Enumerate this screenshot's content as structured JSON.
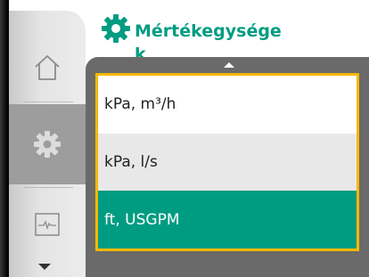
{
  "header": {
    "icon": "gear-icon",
    "title": "Mértékegységek"
  },
  "sidebar": {
    "items": [
      {
        "name": "home",
        "icon": "home-icon",
        "selected": false
      },
      {
        "name": "settings",
        "icon": "gear-icon",
        "selected": true
      },
      {
        "name": "diagnostics",
        "icon": "waveform-icon",
        "selected": false
      }
    ]
  },
  "units_list": {
    "options": [
      {
        "label": "kPa, m³/h",
        "selected": false
      },
      {
        "label": "kPa, l/s",
        "selected": false
      },
      {
        "label": "ft, USGPM",
        "selected": true
      }
    ]
  },
  "colors": {
    "accent": "#009c82",
    "focus": "#f5b800",
    "panel": "#6a6a6a"
  }
}
